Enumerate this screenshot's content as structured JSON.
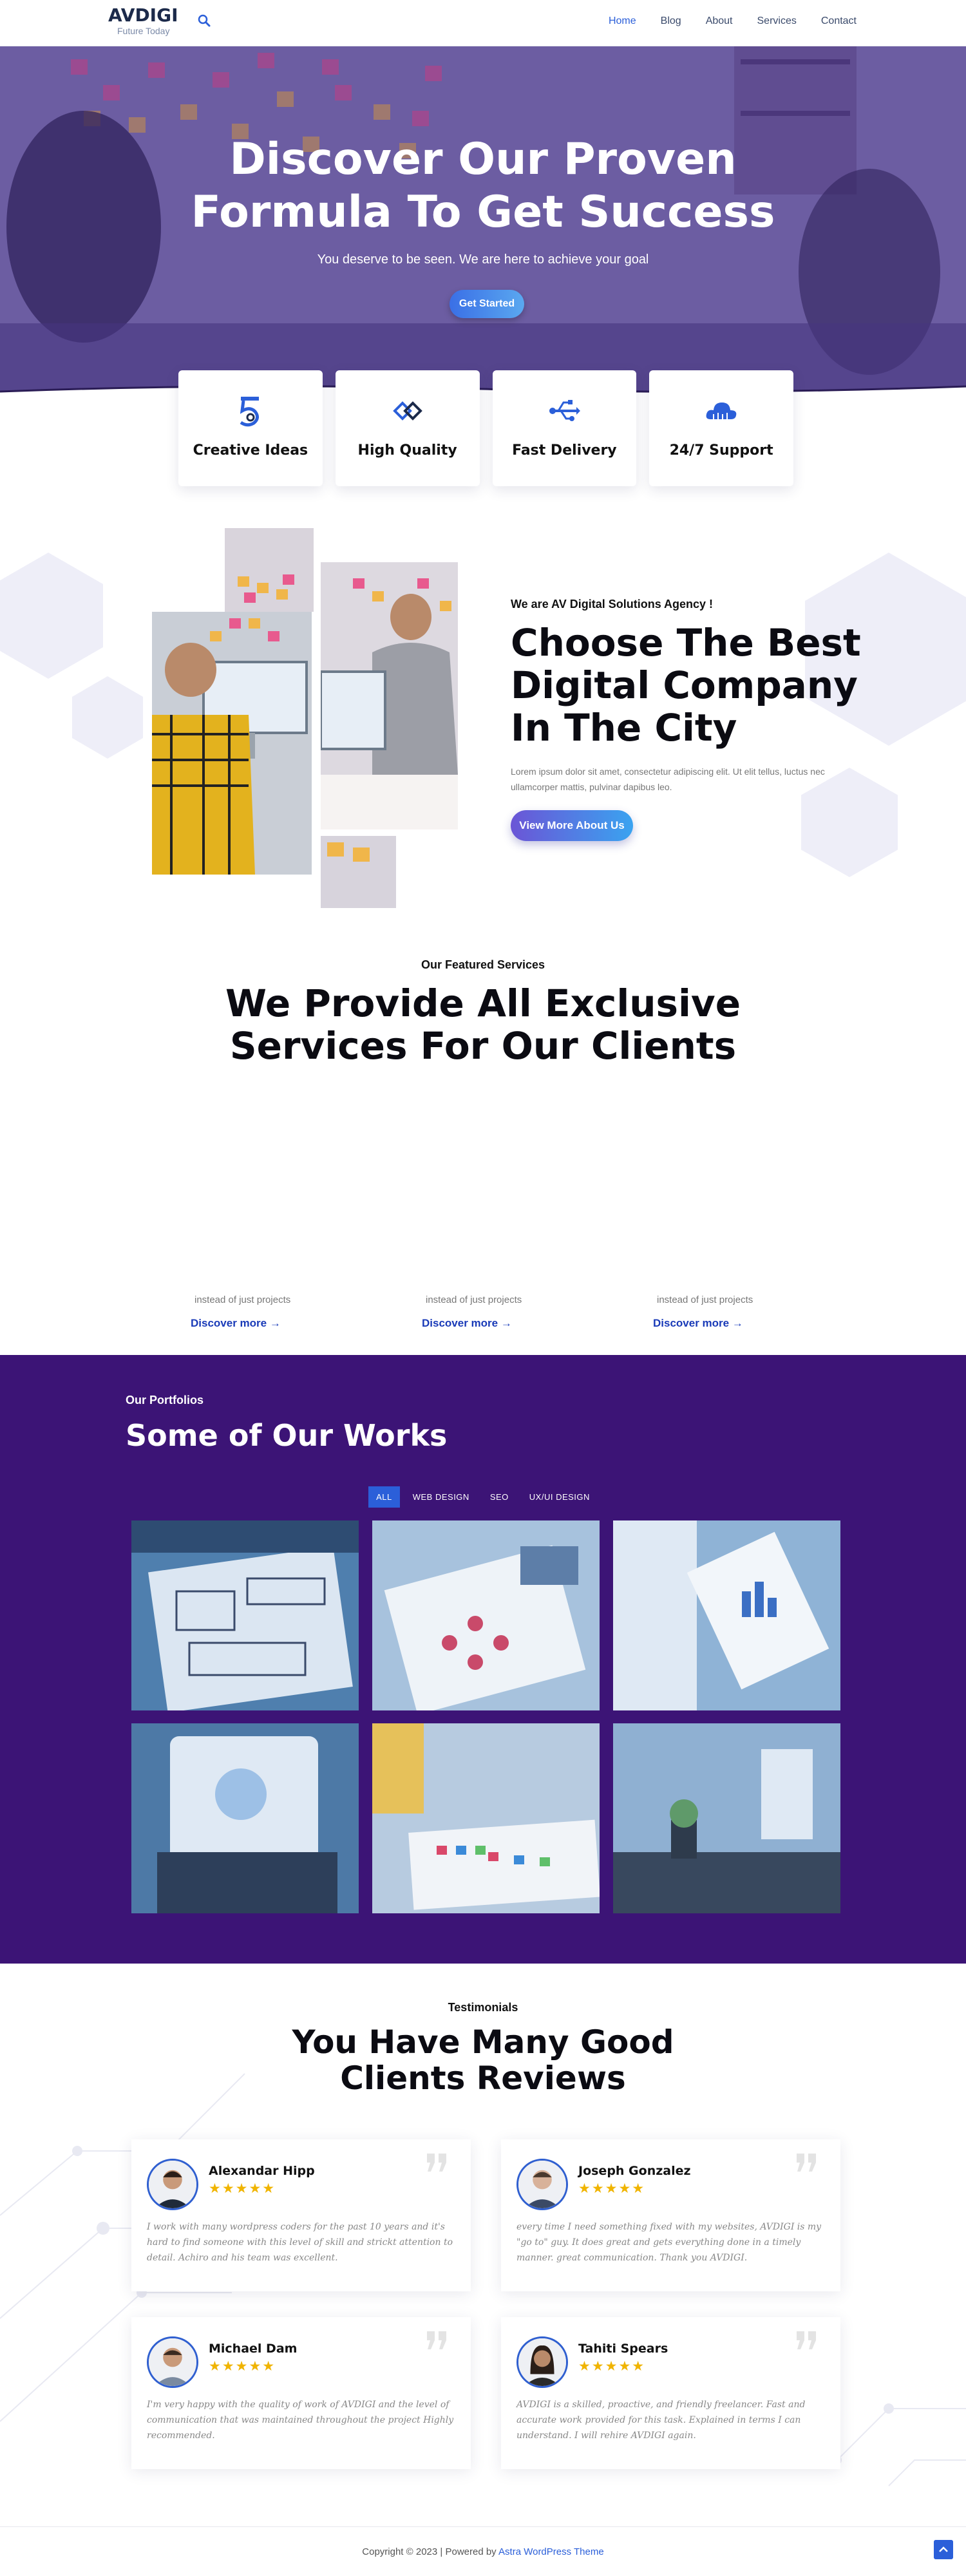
{
  "header": {
    "brand": "AVDIGI",
    "tagline": "Future Today",
    "nav": [
      "Home",
      "Blog",
      "About",
      "Services",
      "Contact"
    ],
    "active": "Home"
  },
  "hero": {
    "title_line1": "Discover Our Proven",
    "title_line2": "Formula To Get Success",
    "subtitle": "You deserve to be seen. We are here to achieve your goal",
    "cta": "Get Started"
  },
  "features": [
    {
      "label": "Creative Ideas",
      "icon": "number-five-icon"
    },
    {
      "label": "High Quality",
      "icon": "diamond-link-icon"
    },
    {
      "label": "Fast Delivery",
      "icon": "usb-icon"
    },
    {
      "label": "24/7 Support",
      "icon": "cloud-icon"
    }
  ],
  "about": {
    "eyebrow": "We are AV Digital Solutions Agency !",
    "title": "Choose The Best Digital Company In The City",
    "body": "Lorem ipsum dolor sit amet, consectetur adipiscing elit. Ut elit tellus, luctus nec ullamcorper mattis, pulvinar dapibus leo.",
    "button": "View More About Us"
  },
  "services": {
    "eyebrow": "Our Featured Services",
    "title_line1": "We Provide All Exclusive",
    "title_line2": "Services For Our Clients",
    "items": [
      {
        "note": "instead of just projects",
        "link": "Discover more →"
      },
      {
        "note": "instead of just projects",
        "link": "Discover more →"
      },
      {
        "note": "instead of just projects",
        "link": "Discover more →"
      }
    ]
  },
  "portfolio": {
    "eyebrow": "Our Portfolios",
    "title": "Some of Our Works",
    "filters": [
      "ALL",
      "WEB DESIGN",
      "SEO",
      "UX/UI DESIGN"
    ],
    "active_filter": "ALL"
  },
  "testimonials": {
    "eyebrow": "Testimonials",
    "title_line1": "You Have Many Good",
    "title_line2": "Clients Reviews",
    "items": [
      {
        "name": "Alexandar Hipp",
        "stars": "★★★★★",
        "rating": 5,
        "text": "I work with many wordpress coders for the past 10 years and it's hard to find someone with this level of skill and strickt attention to detail. Achiro and his team was excellent."
      },
      {
        "name": "Joseph Gonzalez",
        "stars": "★★★★★",
        "rating": 5,
        "text": "every time I need something fixed with my websites, AVDIGI is my \"go to\" guy. It does great and gets everything done in a timely manner. great communication. Thank you AVDIGI."
      },
      {
        "name": "Michael Dam",
        "stars": "★★★★★",
        "rating": 5,
        "text": "I'm very happy with the quality of work of AVDIGI and the level of communication that was maintained throughout the project Highly recommended."
      },
      {
        "name": "Tahiti Spears",
        "stars": "★★★★★",
        "rating": 5,
        "text": "AVDIGI is a skilled, proactive, and friendly freelancer. Fast and accurate work provided for this task. Explained in terms I can understand. I will rehire AVDIGI again."
      }
    ]
  },
  "footer": {
    "copyright": "Copyright © 2023 | Powered by ",
    "theme_link": "Astra WordPress Theme"
  },
  "colors": {
    "accent": "#2b5fd9",
    "portfolio_bg": "#3c1476",
    "star": "#f0b400"
  }
}
